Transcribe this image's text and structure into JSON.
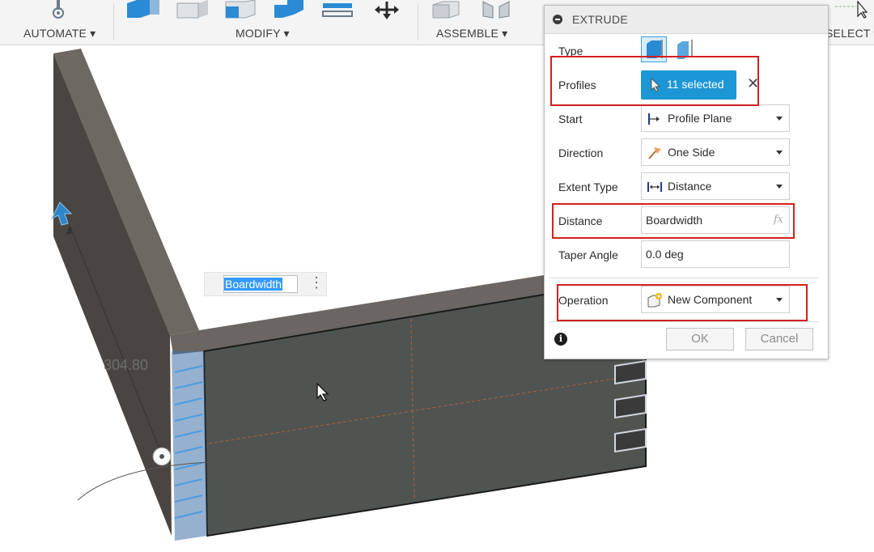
{
  "toolbar": {
    "automate_label": "AUTOMATE ▾",
    "modify_label": "MODIFY ▾",
    "assemble_label": "ASSEMBLE ▾",
    "select_label": "SELECT ▾"
  },
  "viewport": {
    "dimension_value": "304.80",
    "inline_input_value": "Boardwidth"
  },
  "dialog": {
    "title": "EXTRUDE",
    "type_label": "Type",
    "profiles_label": "Profiles",
    "profiles_value": "11 selected",
    "start_label": "Start",
    "start_value": "Profile Plane",
    "direction_label": "Direction",
    "direction_value": "One Side",
    "extent_label": "Extent Type",
    "extent_value": "Distance",
    "distance_label": "Distance",
    "distance_value": "Boardwidth",
    "fx_label": "fx",
    "taper_label": "Taper Angle",
    "taper_value": "0.0 deg",
    "operation_label": "Operation",
    "operation_value": "New Component",
    "ok_label": "OK",
    "cancel_label": "Cancel",
    "info_glyph": "i",
    "clear_glyph": "✕"
  },
  "colors": {
    "accent_blue": "#1d96d6",
    "highlight_red": "#d32020",
    "board_face": "#4e5350",
    "board_edge": "#6b6661"
  }
}
